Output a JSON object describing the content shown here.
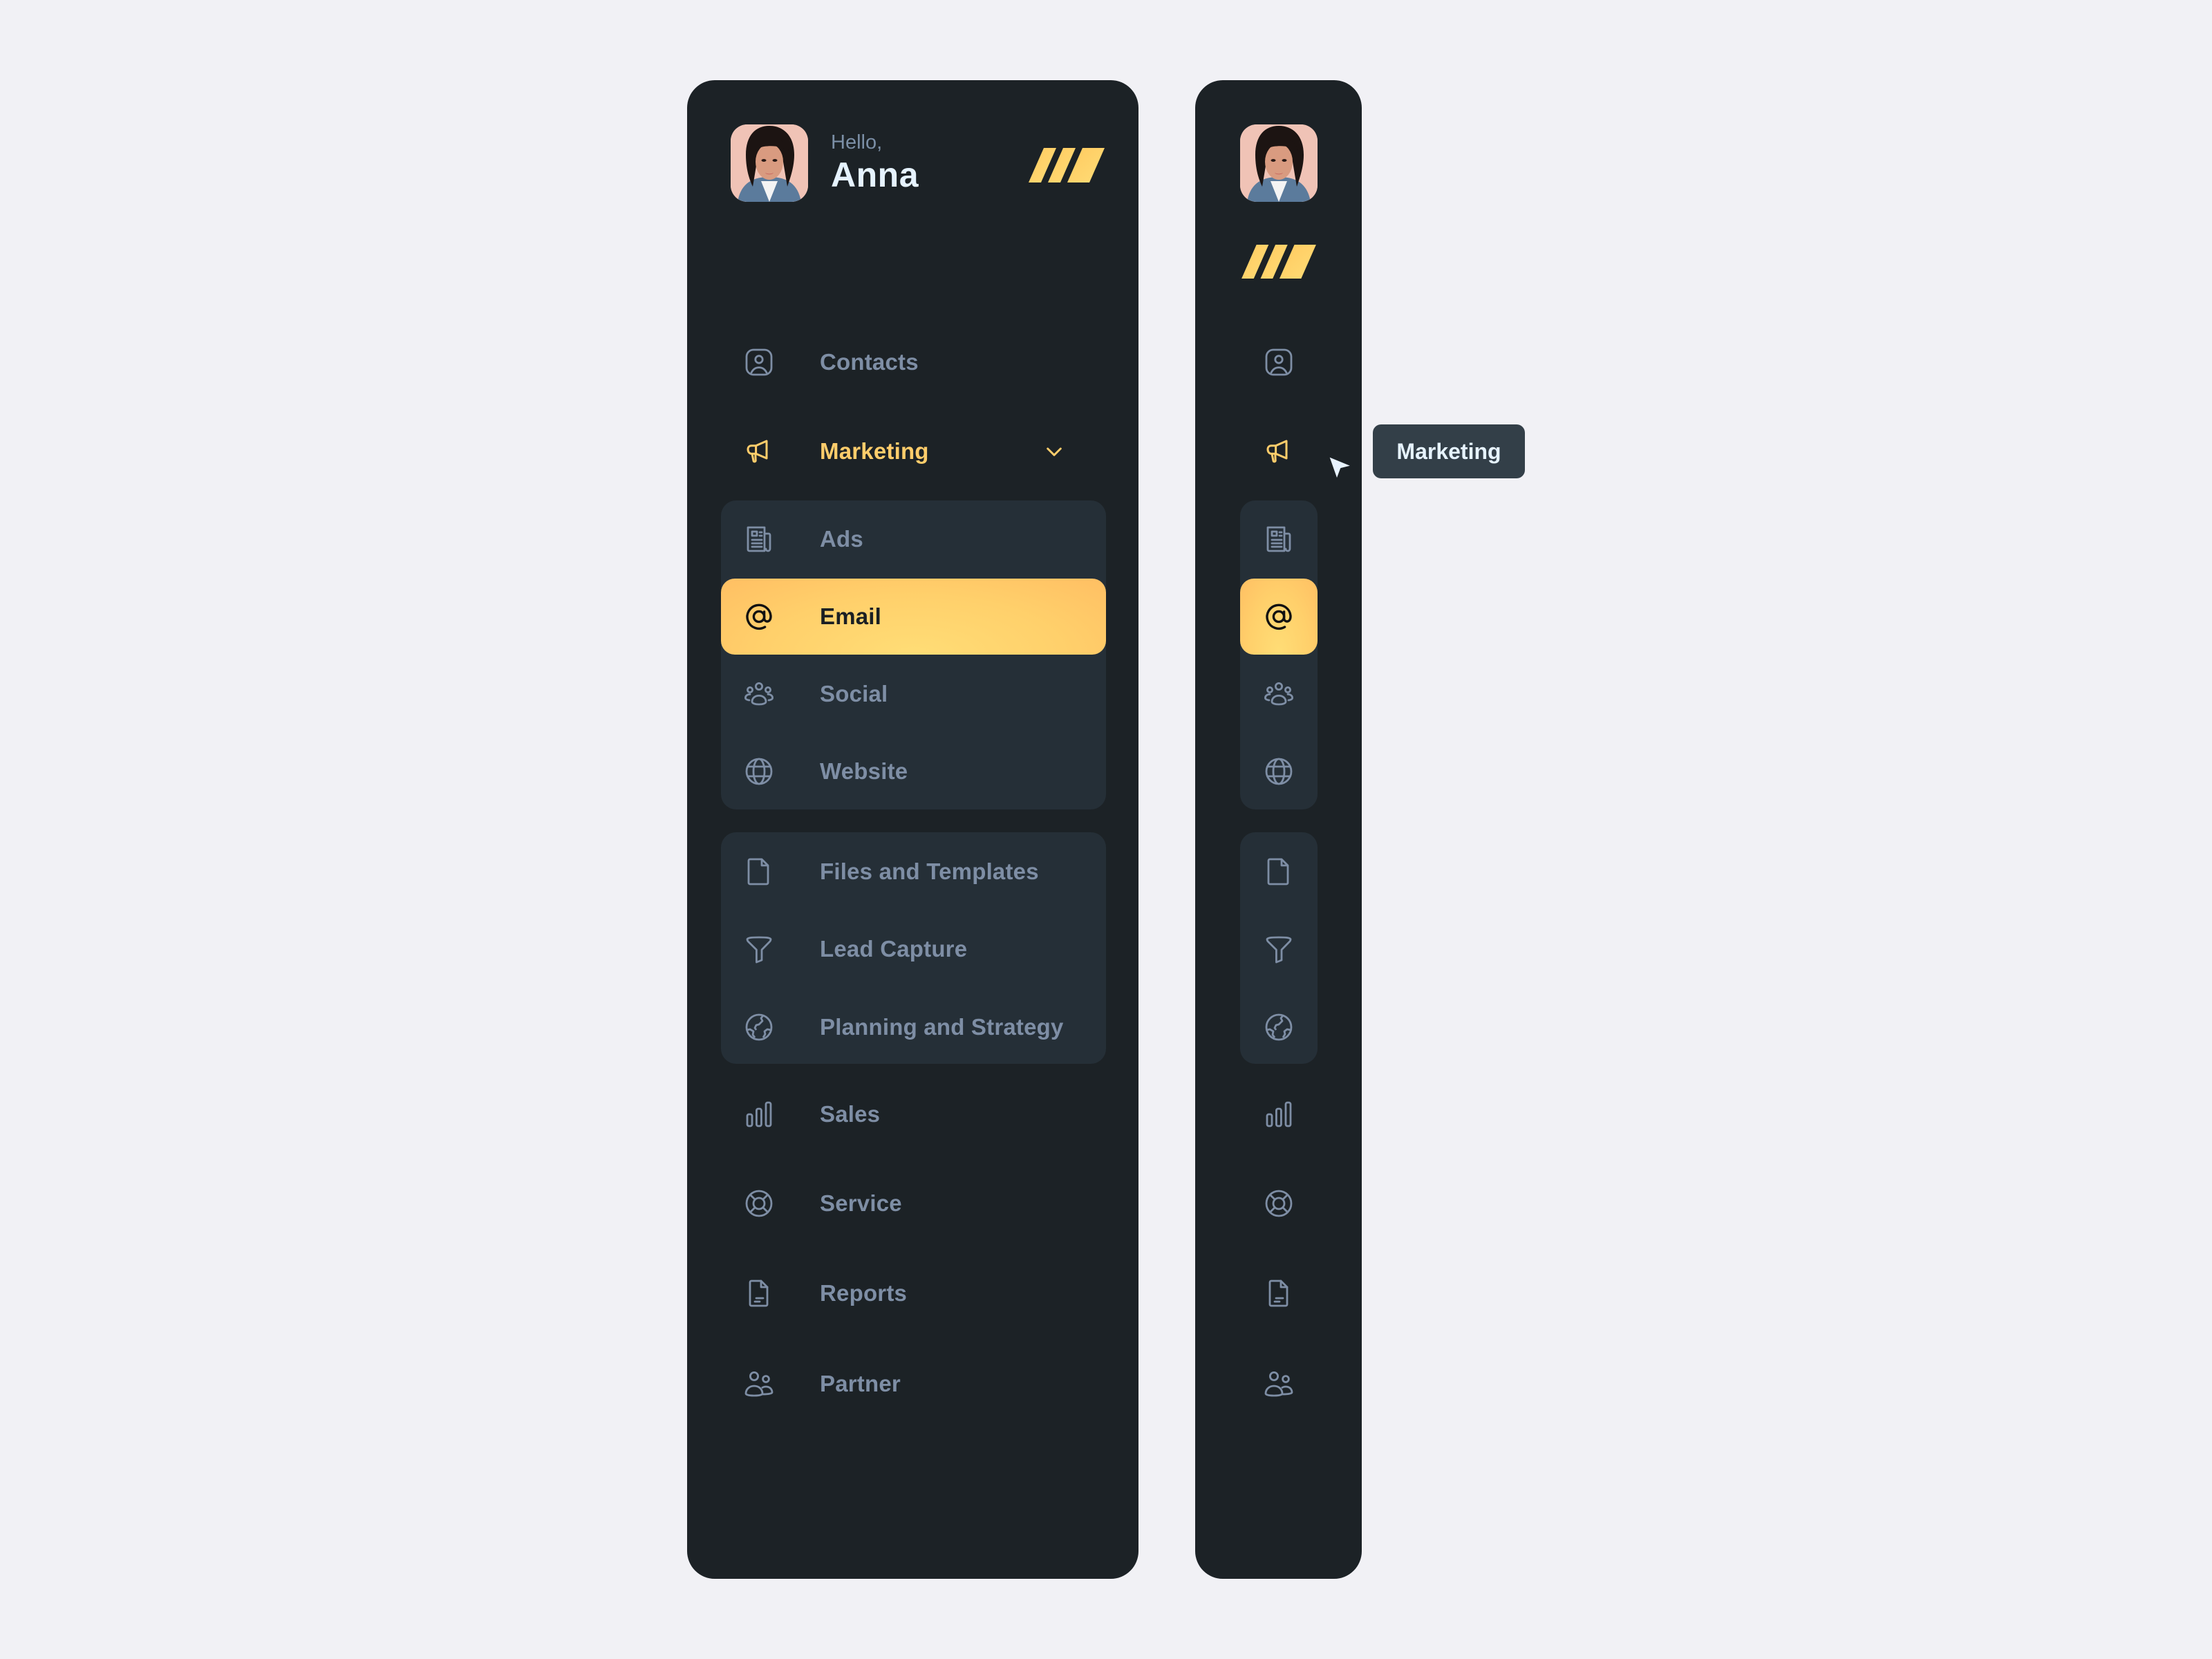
{
  "user": {
    "greeting": "Hello,",
    "name": "Anna"
  },
  "colors": {
    "background": "#f1f1f5",
    "panel": "#1c2226",
    "group": "#252f37",
    "accent": "#ffcd6b",
    "muted_text": "#7e8ea5",
    "tooltip_bg": "#333f48"
  },
  "nav": {
    "contacts": {
      "label": "Contacts",
      "icon": "contact-card-icon"
    },
    "marketing": {
      "label": "Marketing",
      "icon": "megaphone-icon",
      "expanded": true
    },
    "marketing_children": [
      {
        "label": "Ads",
        "icon": "newspaper-icon"
      },
      {
        "label": "Email",
        "icon": "at-sign-icon",
        "active": true
      },
      {
        "label": "Social",
        "icon": "people-group-icon"
      },
      {
        "label": "Website",
        "icon": "globe-icon"
      }
    ],
    "tools": [
      {
        "label": "Files and Templates",
        "icon": "file-icon"
      },
      {
        "label": "Lead Capture",
        "icon": "funnel-icon"
      },
      {
        "label": "Planning and Strategy",
        "icon": "earth-icon"
      }
    ],
    "bottom": [
      {
        "label": "Sales",
        "icon": "bar-chart-icon"
      },
      {
        "label": "Service",
        "icon": "lifebuoy-icon"
      },
      {
        "label": "Reports",
        "icon": "report-document-icon"
      },
      {
        "label": "Partner",
        "icon": "users-icon"
      }
    ]
  },
  "tooltip": {
    "text": "Marketing"
  }
}
